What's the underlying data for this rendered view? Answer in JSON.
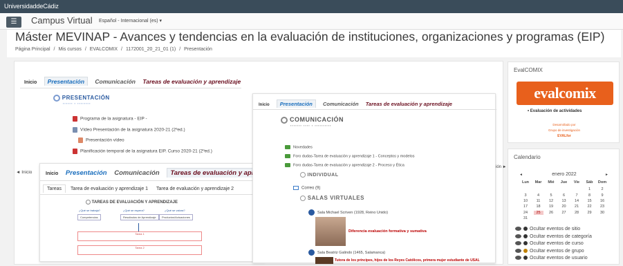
{
  "topbar": {
    "university": "UniversidaddeCádiz"
  },
  "navbar": {
    "site_name": "Campus Virtual",
    "language": "Español - Internacional (es) ▾",
    "menu_icon": "☰"
  },
  "header": {
    "title": "Máster MEVINAP - Avances y tendencias en la evaluación de instituciones, organizaciones y programas (EIP)",
    "breadcrumb": [
      "Página Principal",
      "/",
      "Mis cursos",
      "/",
      "EVALCOMIX",
      "/",
      "1172001_20_21_01 (1)",
      "/",
      "Presentación"
    ]
  },
  "block1": {
    "tabs": [
      "Inicio",
      "Presentación",
      "Comunicación",
      "Tareas de evaluación y aprendizaje"
    ],
    "heading": "PRESENTACIÓN",
    "items": [
      "Programa de la asignatura - EIP -",
      "Vídeo Presentación de la asignatura 2020-21 (2ºed.)",
      "Presentación vídeo",
      "Planificación temporal de la asignatura EIP. Curso 2020-21 (2ºed.)"
    ],
    "nav_left": "◄ Inicio"
  },
  "block2": {
    "tabs": [
      "Inicio",
      "Presentación",
      "Comunicación",
      "Tareas de evaluación y aprendizaje"
    ],
    "heading": "COMUNICACIÓN",
    "items": [
      "Novedades",
      "Foro dudas-Tarea de evaluación y aprendizaje 1 - Conceptos y modelos",
      "Foro dudas-Tarea de evaluación y aprendizaje 2 - Proceso y Ética"
    ],
    "individual": "INDIVIDUAL",
    "correo": "Correo (9)",
    "salas": "SALAS VIRTUALES",
    "sala1": "Sala Michael Scriven (1928, Reino Unido)",
    "sala1_caption": "Diferencia evaluación formativa y sumativa",
    "sala2": "Sala Beatriz Galindo (1465, Salamanca)",
    "sala2_caption": "Tutora de los príncipes, hijos de los Reyes Católicos, primera mujer estudiante de USAL",
    "nav_right": "ión ►"
  },
  "block3": {
    "tabs": [
      "Inicio",
      "Presentación",
      "Comunicación",
      "Tareas de evaluación y aprendizaje"
    ],
    "subtabs": [
      "Tareas",
      "Tarea de evaluación y aprendizaje 1",
      "Tarea de evaluación y aprendizaje 2"
    ],
    "diagram_title": "TAREAS DE EVALUACIÓN Y APRENDIZAJE",
    "col1": "¿Qué se trabaja?",
    "col2": "¿Qué se espera?",
    "col3": "¿Qué se valora?",
    "r1": "Competencias",
    "r2": "Resultados de Aprendizaje",
    "r3": "Productos/Actuaciones",
    "task1": "Tarea 1",
    "task2": "Tarea 2"
  },
  "evalcomix": {
    "title": "EvalCOMIX",
    "logo": "evalcomix",
    "bullet": "Evaluación de actividades",
    "dev1": "Desarrollado por",
    "dev2": "Grupo de investigación",
    "dev3": "EVALfor"
  },
  "calendar": {
    "title": "Calendario",
    "prev": "◄",
    "month": "enero 2022",
    "next": "►",
    "days": [
      "Lun",
      "Mar",
      "Mié",
      "Jue",
      "Vie",
      "Sáb",
      "Dom"
    ],
    "weeks": [
      [
        "",
        "",
        "",
        "",
        "",
        "1",
        "2"
      ],
      [
        "3",
        "4",
        "5",
        "6",
        "7",
        "8",
        "9"
      ],
      [
        "10",
        "11",
        "12",
        "13",
        "14",
        "15",
        "16"
      ],
      [
        "17",
        "18",
        "19",
        "20",
        "21",
        "22",
        "23"
      ],
      [
        "24",
        "25",
        "26",
        "27",
        "28",
        "29",
        "30"
      ],
      [
        "31",
        "",
        "",
        "",
        "",
        "",
        ""
      ]
    ],
    "today": "25",
    "events": [
      "Ocultar eventos de sitio",
      "Ocultar eventos de categoría",
      "Ocultar eventos de curso",
      "Ocultar eventos de grupo",
      "Ocultar eventos de usuario"
    ],
    "event_colors": [
      "#333333",
      "#333333",
      "#333333",
      "#c08000",
      "#333333"
    ]
  }
}
